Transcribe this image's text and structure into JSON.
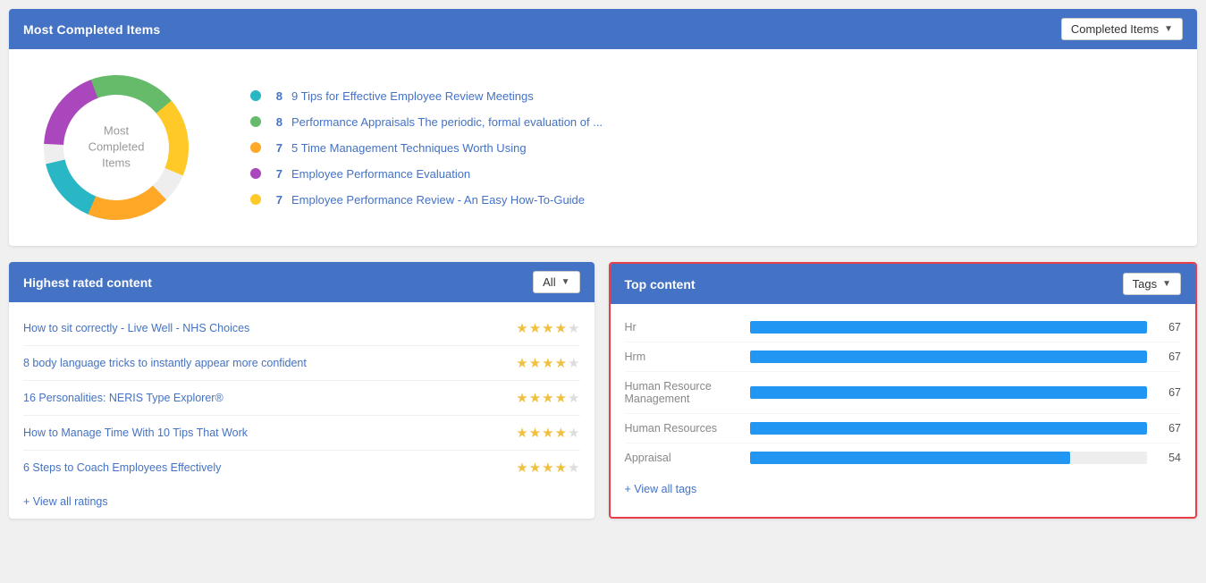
{
  "top_card": {
    "title": "Most Completed Items",
    "dropdown_label": "Completed Items",
    "donut_center_text": "Most\nCompleted\nItems",
    "legend": [
      {
        "color": "#29B6C5",
        "count": "8",
        "label": "9 Tips for Effective Employee Review Meetings",
        "pct": 22
      },
      {
        "color": "#66BB6A",
        "count": "8",
        "label": "Performance Appraisals The periodic, formal evaluation of ...",
        "pct": 22
      },
      {
        "color": "#FFA726",
        "count": "7",
        "label": "5 Time Management Techniques Worth Using",
        "pct": 19
      },
      {
        "color": "#AB47BC",
        "count": "7",
        "label": "Employee Performance Evaluation",
        "pct": 19
      },
      {
        "color": "#FFCA28",
        "count": "7",
        "label": "Employee Performance Review - An Easy How-To-Guide",
        "pct": 18
      }
    ],
    "donut_segments": [
      {
        "color": "#29B6C5",
        "pct": 22
      },
      {
        "color": "#66BB6A",
        "pct": 22
      },
      {
        "color": "#FFA726",
        "pct": 19
      },
      {
        "color": "#AB47BC",
        "pct": 19
      },
      {
        "color": "#FFCA28",
        "pct": 18
      }
    ]
  },
  "highest_rated": {
    "title": "Highest rated content",
    "dropdown_label": "All",
    "items": [
      {
        "label": "How to sit correctly - Live Well - NHS Choices",
        "stars": 4
      },
      {
        "label": "8 body language tricks to instantly appear more confident",
        "stars": 4
      },
      {
        "label": "16 Personalities: NERIS Type Explorer®",
        "stars": 4
      },
      {
        "label": "How to Manage Time With 10 Tips That Work",
        "stars": 4
      },
      {
        "label": "6 Steps to Coach Employees Effectively",
        "stars": 4
      }
    ],
    "view_all_label": "+ View all ratings"
  },
  "top_content": {
    "title": "Top content",
    "dropdown_label": "Tags",
    "bars": [
      {
        "label": "Hr",
        "value": 67,
        "max": 67
      },
      {
        "label": "Hrm",
        "value": 67,
        "max": 67
      },
      {
        "label": "Human Resource Management",
        "value": 67,
        "max": 67
      },
      {
        "label": "Human Resources",
        "value": 67,
        "max": 67
      },
      {
        "label": "Appraisal",
        "value": 54,
        "max": 67
      }
    ],
    "view_all_label": "+ View all tags"
  }
}
